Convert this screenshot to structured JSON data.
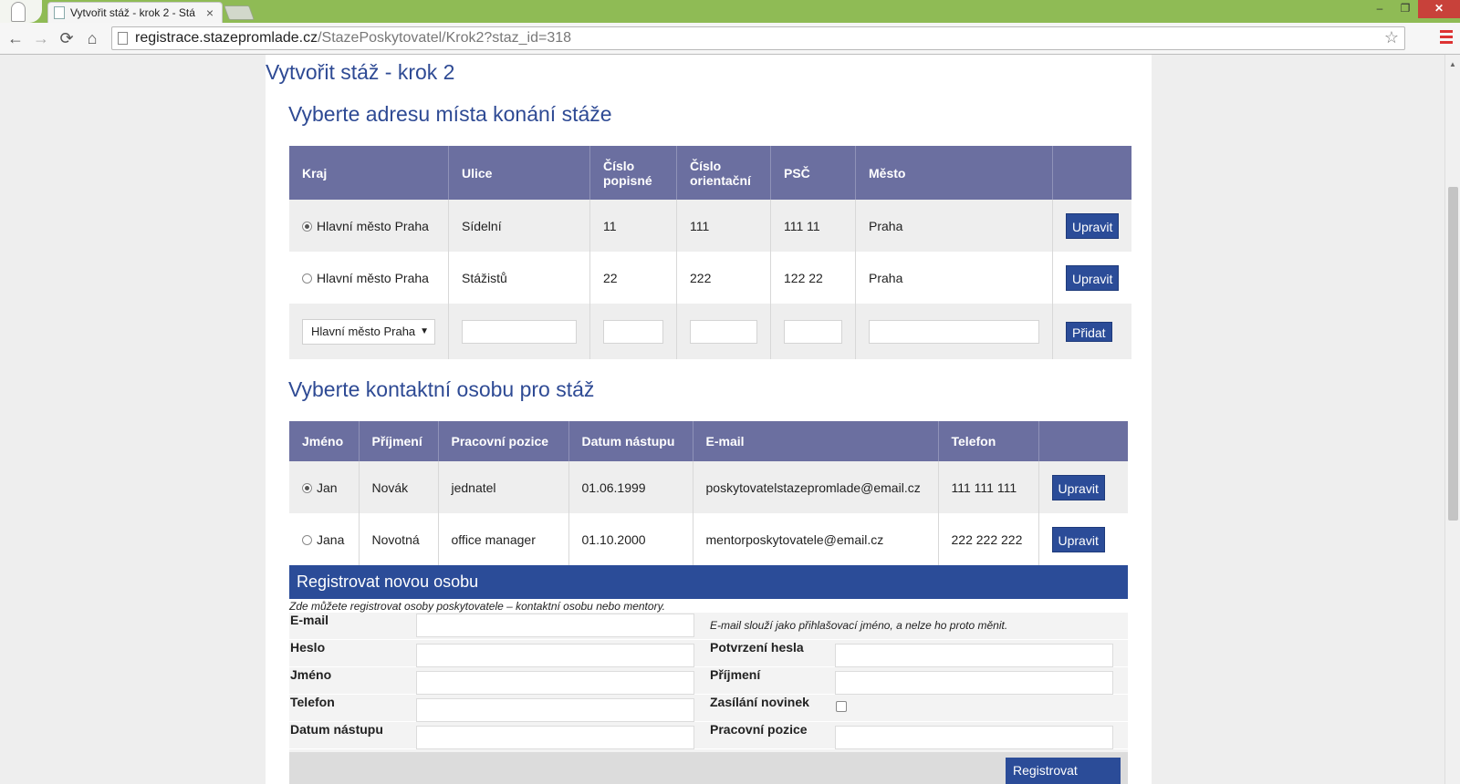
{
  "browser": {
    "tab_title": "Vytvořit stáž - krok 2 - Stá",
    "tab_close": "×",
    "url_host": "registrace.stazepromlade.cz",
    "url_path": "/StazePoskytovatel/Krok2?staz_id=318",
    "win_minimize": "–",
    "win_restore": "❐",
    "win_close": "✕",
    "back": "←",
    "forward": "→",
    "reload": "⟳",
    "home": "⌂",
    "star": "☆"
  },
  "page": {
    "title": "Vytvořit stáž - krok 2"
  },
  "address_section": {
    "title": "Vyberte adresu místa konání stáže",
    "headers": [
      "Kraj",
      "Ulice",
      "Číslo popisné",
      "Číslo orientační",
      "PSČ",
      "Město",
      ""
    ],
    "rows": [
      {
        "kraj": "Hlavní město Praha",
        "ulice": "Sídelní",
        "cp": "11",
        "co": "111",
        "psc": "111 11",
        "mesto": "Praha",
        "action": "Upravit",
        "selected": true
      },
      {
        "kraj": "Hlavní město Praha",
        "ulice": "Stážistů",
        "cp": "22",
        "co": "222",
        "psc": "122 22",
        "mesto": "Praha",
        "action": "Upravit",
        "selected": false
      }
    ],
    "new_row": {
      "kraj_selected": "Hlavní město Praha",
      "caret": "▼",
      "add_label": "Přidat"
    }
  },
  "contact_section": {
    "title": "Vyberte kontaktní osobu pro stáž",
    "headers": [
      "Jméno",
      "Příjmení",
      "Pracovní pozice",
      "Datum nástupu",
      "E-mail",
      "Telefon",
      ""
    ],
    "rows": [
      {
        "jmeno": "Jan",
        "prijmeni": "Novák",
        "pozice": "jednatel",
        "datum": "01.06.1999",
        "email": "poskytovatelstazepromlade@email.cz",
        "telefon": "111 111 111",
        "action": "Upravit",
        "selected": true
      },
      {
        "jmeno": "Jana",
        "prijmeni": "Novotná",
        "pozice": "office manager",
        "datum": "01.10.2000",
        "email": "mentorposkytovatele@email.cz",
        "telefon": "222 222 222",
        "action": "Upravit",
        "selected": false
      }
    ]
  },
  "registration": {
    "title": "Registrovat novou osobu",
    "intro": "Zde můžete registrovat osoby poskytovatele – kontaktní osobu nebo mentory.",
    "email_label": "E-mail",
    "email_note": "E-mail slouží jako přihlašovací jméno, a nelze ho proto měnit.",
    "heslo_label": "Heslo",
    "potvrzeni_label": "Potvrzení hesla",
    "jmeno_label": "Jméno",
    "prijmeni_label": "Příjmení",
    "telefon_label": "Telefon",
    "novinky_label": "Zasílání novinek",
    "datum_label": "Datum nástupu",
    "pozice_label": "Pracovní pozice",
    "submit_label": "Registrovat"
  }
}
